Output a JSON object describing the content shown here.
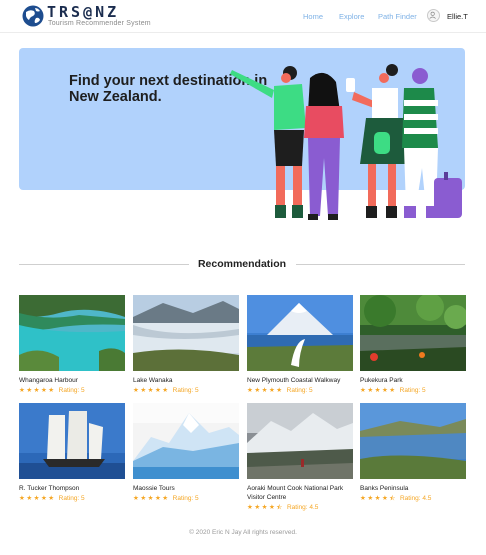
{
  "brand": {
    "name": "TRS@NZ",
    "tagline": "Tourism Recommender System"
  },
  "nav": {
    "home": "Home",
    "explore": "Explore",
    "path_finder": "Path Finder",
    "user_name": "Ellie.T"
  },
  "hero": {
    "title": "Find your next destination in New Zealand."
  },
  "section": {
    "title": "Recommendation"
  },
  "places": [
    {
      "name": "Whangaroa Harbour",
      "rating_label": "Rating: 5",
      "stars": 5
    },
    {
      "name": "Lake Wanaka",
      "rating_label": "Rating: 5",
      "stars": 5
    },
    {
      "name": "New Plymouth Coastal Walkway",
      "rating_label": "Rating: 5",
      "stars": 5
    },
    {
      "name": "Pukekura Park",
      "rating_label": "Rating: 5",
      "stars": 5
    },
    {
      "name": "R. Tucker Thompson",
      "rating_label": "Rating: 5",
      "stars": 5
    },
    {
      "name": "Maossie Tours",
      "rating_label": "Rating: 5",
      "stars": 5
    },
    {
      "name": "Aoraki Mount Cook National Park Visitor Centre",
      "rating_label": "Rating: 4.5",
      "stars": 4.5
    },
    {
      "name": "Banks Peninsula",
      "rating_label": "Rating: 4.5",
      "stars": 4.5
    }
  ],
  "footer": {
    "text": "© 2020 Eric N Jay All rights reserved."
  },
  "colors": {
    "hero_bg": "#b1d2fc",
    "nav_link": "#7fb2e6",
    "star": "#f5a623",
    "brand_text": "#1b2d4f"
  }
}
